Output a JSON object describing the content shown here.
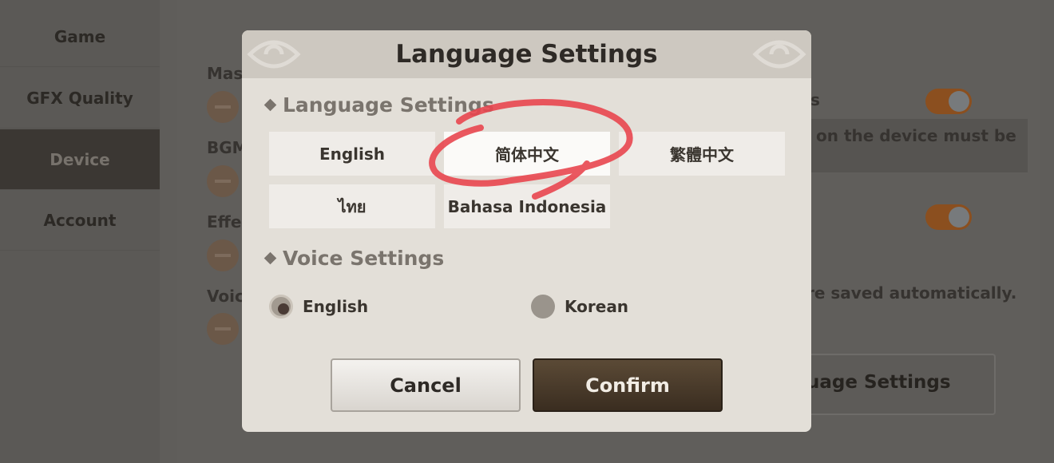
{
  "sidebar": {
    "items": [
      {
        "label": "Game"
      },
      {
        "label": "GFX Quality"
      },
      {
        "label": "Device",
        "selected": true
      },
      {
        "label": "Account"
      }
    ]
  },
  "background": {
    "labels": [
      "Mas",
      "BGM",
      "Effe",
      "Voic"
    ],
    "toggle_label_fragment": "s",
    "note_fragment": "on the device must be",
    "saved_fragment": "re saved automatically.",
    "button_fragment": "uage Settings",
    "toggles": [
      {
        "on": true
      },
      {
        "on": true
      }
    ]
  },
  "modal": {
    "title": "Language Settings",
    "language_section": "Language Settings",
    "languages": [
      {
        "label": "English"
      },
      {
        "label": "简体中文",
        "selected": true
      },
      {
        "label": "繁體中文"
      },
      {
        "label": "ไทย"
      },
      {
        "label": "Bahasa Indonesia"
      }
    ],
    "voice_section": "Voice Settings",
    "voices": [
      {
        "label": "English",
        "selected": true
      },
      {
        "label": "Korean",
        "selected": false
      }
    ],
    "cancel_label": "Cancel",
    "confirm_label": "Confirm"
  },
  "colors": {
    "annotation": "#e8464f",
    "confirm": "#4a3b2b",
    "toggle": "#8b4f1f"
  }
}
